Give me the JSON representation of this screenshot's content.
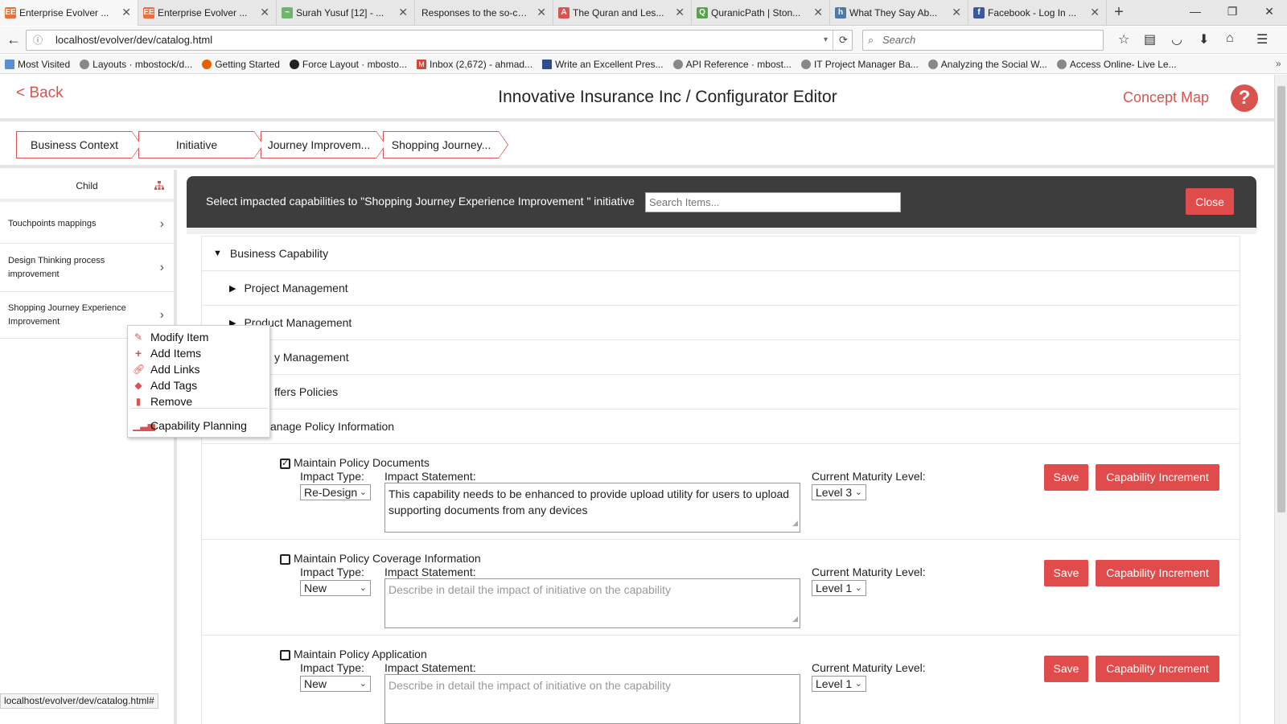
{
  "browser": {
    "tabs": [
      {
        "title": "Enterprise Evolver ...",
        "favicon": "EE",
        "color": "#e8703a"
      },
      {
        "title": "Enterprise Evolver ...",
        "favicon": "EE",
        "color": "#e8703a"
      },
      {
        "title": "Surah Yusuf [12] - ...",
        "favicon": "~",
        "color": "#6fb46f"
      },
      {
        "title": "Responses to the so-ca...",
        "favicon": "",
        "color": "#cccccc"
      },
      {
        "title": "The Quran and Les...",
        "favicon": "A",
        "color": "#d9534f"
      },
      {
        "title": "QuranicPath | Ston...",
        "favicon": "Q",
        "color": "#59a14f"
      },
      {
        "title": "What They Say Ab...",
        "favicon": "h",
        "color": "#4e79a7"
      },
      {
        "title": "Facebook - Log In ...",
        "favicon": "f",
        "color": "#3b5998"
      }
    ],
    "new_tab": "+",
    "url": "localhost/evolver/dev/catalog.html",
    "search_placeholder": "Search",
    "bookmarks": [
      "Most Visited",
      "Layouts · mbostock/d...",
      "Getting Started",
      "Force Layout · mbosto...",
      "Inbox (2,672) - ahmad...",
      "Write an Excellent Pres...",
      "API Reference · mbost...",
      "IT Project Manager Ba...",
      "Analyzing the Social W...",
      "Access Online- Live Le..."
    ]
  },
  "header": {
    "back": "< Back",
    "title": "Innovative Insurance Inc / Configurator Editor",
    "concept_map": "Concept Map",
    "help": "?"
  },
  "breadcrumbs": [
    "Business Context",
    "Initiative",
    "Journey Improvem...",
    "Shopping Journey..."
  ],
  "sidebar": {
    "child_label": "Child",
    "items": [
      {
        "label": "Touchpoints mappings"
      },
      {
        "label": "Design Thinking process improvement"
      },
      {
        "label": "Shopping Journey Experience Improvement"
      }
    ]
  },
  "context_menu": {
    "items": [
      "Modify Item",
      "Add Items",
      "Add Links",
      "Add Tags",
      "Remove"
    ],
    "planning": "Capability Planning"
  },
  "panel": {
    "prompt": "Select impacted capabilities to \"Shopping Journey Experience Improvement \" initiative",
    "search_placeholder": "Search Items...",
    "close": "Close"
  },
  "tree": {
    "root": "Business Capability",
    "nodes": [
      "Project Management",
      "Product Management",
      "y Management",
      "ffers Policies",
      "anage Policy Information"
    ]
  },
  "capabilities": [
    {
      "name": "Maintain Policy Documents",
      "checked": true,
      "impact_type_label": "Impact Type:",
      "impact_type": "Re-Design",
      "statement_label": "Impact Statement:",
      "statement": "This capability needs to be enhanced to provide upload utility for users to upload supporting documents from any devices",
      "maturity_label": "Current Maturity Level:",
      "maturity": "Level 3",
      "save": "Save",
      "increment": "Capability Increment"
    },
    {
      "name": "Maintain Policy Coverage Information",
      "checked": false,
      "impact_type_label": "Impact Type:",
      "impact_type": "New",
      "statement_label": "Impact Statement:",
      "statement": "Describe in detail the impact of initiative on the capability",
      "maturity_label": "Current Maturity Level:",
      "maturity": "Level 1",
      "save": "Save",
      "increment": "Capability Increment"
    },
    {
      "name": "Maintain Policy Application",
      "checked": false,
      "impact_type_label": "Impact Type:",
      "impact_type": "New",
      "statement_label": "Impact Statement:",
      "statement": "Describe in detail the impact of initiative on the capability",
      "maturity_label": "Current Maturity Level:",
      "maturity": "Level 1",
      "save": "Save",
      "increment": "Capability Increment"
    }
  ],
  "status_bar": "localhost/evolver/dev/catalog.html#"
}
